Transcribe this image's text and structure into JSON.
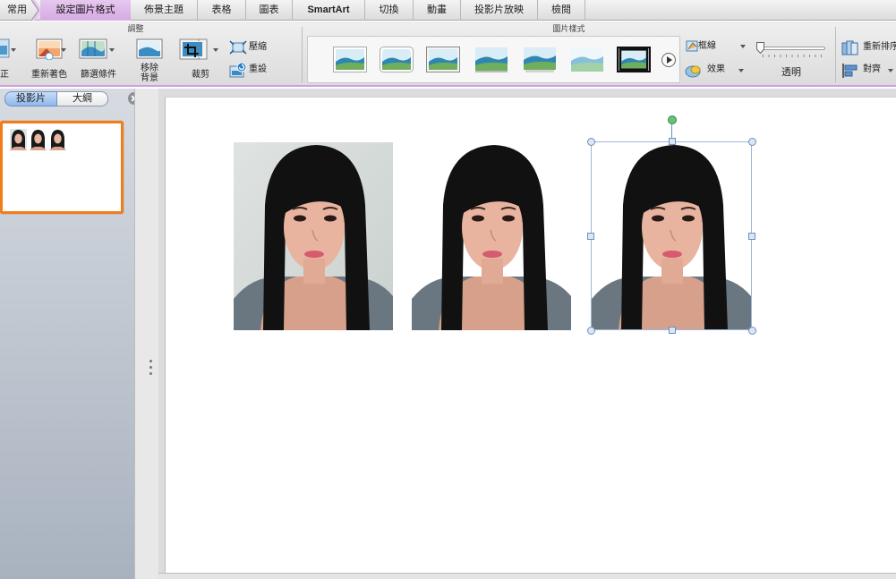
{
  "tabs": [
    {
      "label": "常用"
    },
    {
      "label": "設定圖片格式"
    },
    {
      "label": "佈景主題"
    },
    {
      "label": "表格"
    },
    {
      "label": "圖表"
    },
    {
      "label": "SmartArt"
    },
    {
      "label": "切換"
    },
    {
      "label": "動畫"
    },
    {
      "label": "投影片放映"
    },
    {
      "label": "檢閱"
    }
  ],
  "ribbon": {
    "adjust": {
      "title": "調整",
      "corrections_label": "正",
      "recolor_label": "重新著色",
      "filters_label": "篩選條件",
      "remove_bg_label": "移除\n背景",
      "crop_label": "裁剪",
      "compress_label": "壓縮",
      "reset_label": "重設"
    },
    "picture_styles": {
      "title": "圖片樣式",
      "border_label": "框線",
      "effects_label": "效果",
      "transparency_label": "透明"
    },
    "arrange": {
      "reorder_label": "重新排序",
      "align_label": "對齊"
    }
  },
  "left_pane": {
    "slides_tab": "投影片",
    "outline_tab": "大綱"
  },
  "colors": {
    "active_tab": "#d7a9e4",
    "slide_thumb_border": "#f27d17",
    "selection_handle": "#6e8fbf",
    "rotation_handle": "#6bc07a"
  }
}
